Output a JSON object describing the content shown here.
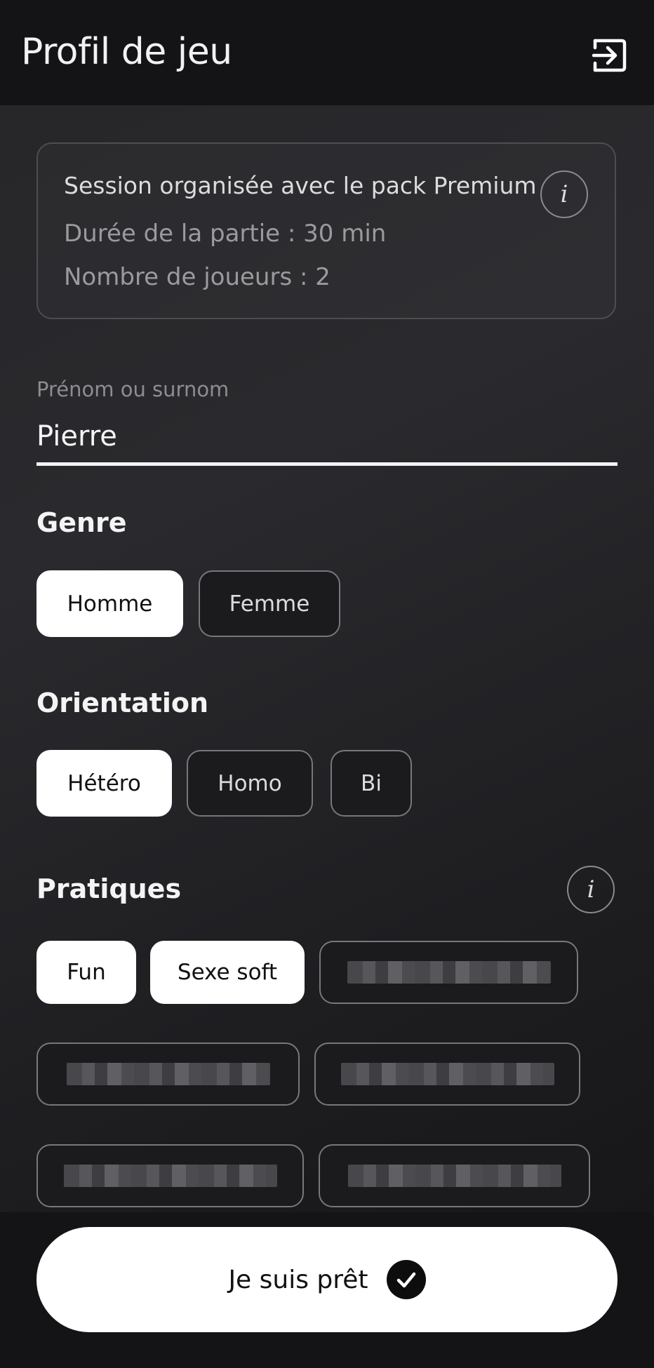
{
  "header": {
    "title": "Profil de jeu",
    "exit_icon": "logout-icon"
  },
  "session_card": {
    "line1": "Session organisée avec le pack Premium",
    "line2": "Durée de la partie : 30 min",
    "line3": "Nombre de joueurs : 2",
    "info_glyph": "i"
  },
  "name_field": {
    "label": "Prénom ou surnom",
    "value": "Pierre"
  },
  "genre": {
    "title": "Genre",
    "options": [
      {
        "label": "Homme",
        "selected": true
      },
      {
        "label": "Femme",
        "selected": false
      }
    ]
  },
  "orientation": {
    "title": "Orientation",
    "options": [
      {
        "label": "Hétéro",
        "selected": true
      },
      {
        "label": "Homo",
        "selected": false
      },
      {
        "label": "Bi",
        "selected": false
      }
    ]
  },
  "pratiques": {
    "title": "Pratiques",
    "info_glyph": "i",
    "options": [
      {
        "label": "Fun",
        "selected": true
      },
      {
        "label": "Sexe soft",
        "selected": true
      }
    ],
    "redacted_count": 5
  },
  "cta": {
    "label": "Je suis prêt",
    "icon": "check-circle-icon"
  },
  "colors": {
    "selected_chip_bg": "#ffffff",
    "unselected_chip_border": "#77777c",
    "background": "#1a1a1d"
  }
}
